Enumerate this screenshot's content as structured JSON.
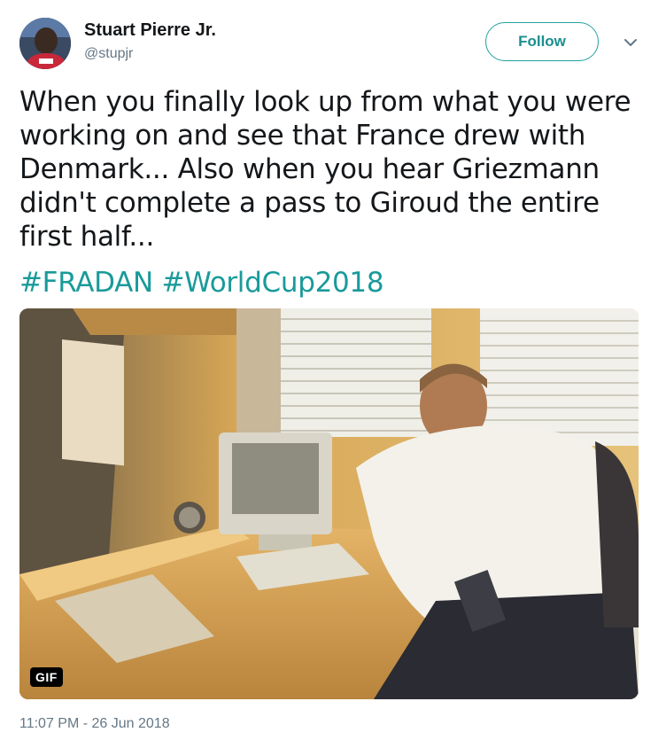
{
  "user": {
    "name": "Stuart Pierre Jr.",
    "handle": "@stupjr",
    "avatar_icon": "profile-photo"
  },
  "actions": {
    "follow_label": "Follow",
    "menu_icon": "chevron-down-icon"
  },
  "tweet": {
    "lines": [
      "When you finally look up from what you were",
      "working on and see that France drew with",
      "Denmark...  Also when you hear Griezmann",
      "didn't complete a pass to Giroud the entire",
      "first half..."
    ],
    "hashtags": [
      "#FRADAN",
      "#WorldCup2018"
    ]
  },
  "media": {
    "badge": "GIF",
    "description_icon": "office-man-computer-gif"
  },
  "footer": {
    "timestamp": "11:07 PM - 26 Jun 2018"
  },
  "colors": {
    "accent": "#1a9a9a",
    "text": "#14171a",
    "muted": "#657786"
  }
}
